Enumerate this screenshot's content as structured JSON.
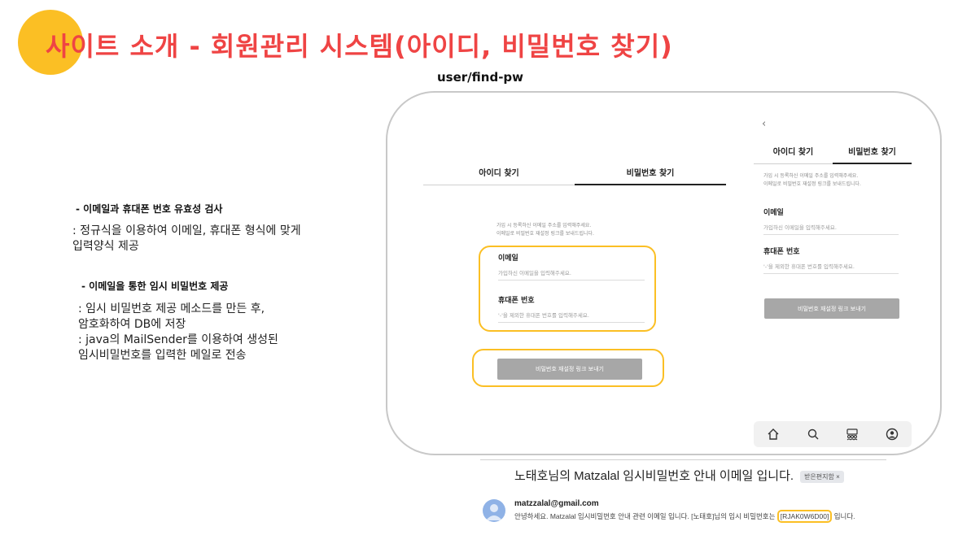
{
  "header": {
    "title": "사이트 소개 - 회원관리 시스템(아이디, 비밀번호 찾기)",
    "route": "user/find-pw",
    "accent_color": "#ef4444",
    "circle_color": "#fbbf24"
  },
  "description": {
    "section1_heading": "- 이메일과 휴대폰 번호 유효성 검사",
    "section1_line1": ": 정규식을 이용하여 이메일, 휴대폰 형식에 맞게",
    "section1_line2": "입력양식 제공",
    "section2_heading": "- 이메일을 통한 임시 비밀번호 제공",
    "section2_line1": ": 임시 비밀번호 제공 메소드를 만든 후,",
    "section2_line2": "암호화하여 DB에 저장",
    "section2_line3": ": java의 MailSender를 이용하여 생성된",
    "section2_line4": "임시비밀번호를 입력한 메일로 전송"
  },
  "desktop_form": {
    "tab_find_id": "아이디 찾기",
    "tab_find_pw": "비밀번호 찾기",
    "hint_line1": "가입 시 등록하신 이메일 주소를 입력해주세요.",
    "hint_line2": "이메일로 비밀번호 재설정 링크를 보내드립니다.",
    "email_label": "이메일",
    "email_placeholder": "가입하신 이메일을 입력해주세요.",
    "phone_label": "휴대폰 번호",
    "phone_placeholder": "'-'을 제외한 휴대폰 번호를 입력해주세요.",
    "submit_label": "비밀번호 재설정 링크 보내기"
  },
  "mobile_form": {
    "back_icon": "chevron-left-icon",
    "tab_find_id": "아이디 찾기",
    "tab_find_pw": "비밀번호 찾기",
    "hint_line1": "가입 시 등록하신 이메일 주소를 입력해주세요.",
    "hint_line2": "이메일로 비밀번호 재설정 링크를 보내드립니다.",
    "email_label": "이메일",
    "email_placeholder": "가입하신 이메일을 입력해주세요.",
    "phone_label": "휴대폰 번호",
    "phone_placeholder": "'-'을 제외한 휴대폰 번호를 입력해주세요.",
    "submit_label": "비밀번호 재설정 링크 보내기",
    "nav_icons": [
      "home-icon",
      "search-icon",
      "community-icon",
      "profile-icon"
    ]
  },
  "email": {
    "subject": "노태호님의 Matzalal 임시비밀번호 안내 이메일 입니다.",
    "tag": "받은편지함 ×",
    "sender": "matzzalal@gmail.com",
    "body_prefix": "안녕하세요. Matzalal 임시비밀번호 안내 관련 이메일 입니다. [노태호]님의 임시 비밀번호는",
    "temp_password": "[RJAK0W6D00]",
    "body_suffix": "입니다."
  }
}
